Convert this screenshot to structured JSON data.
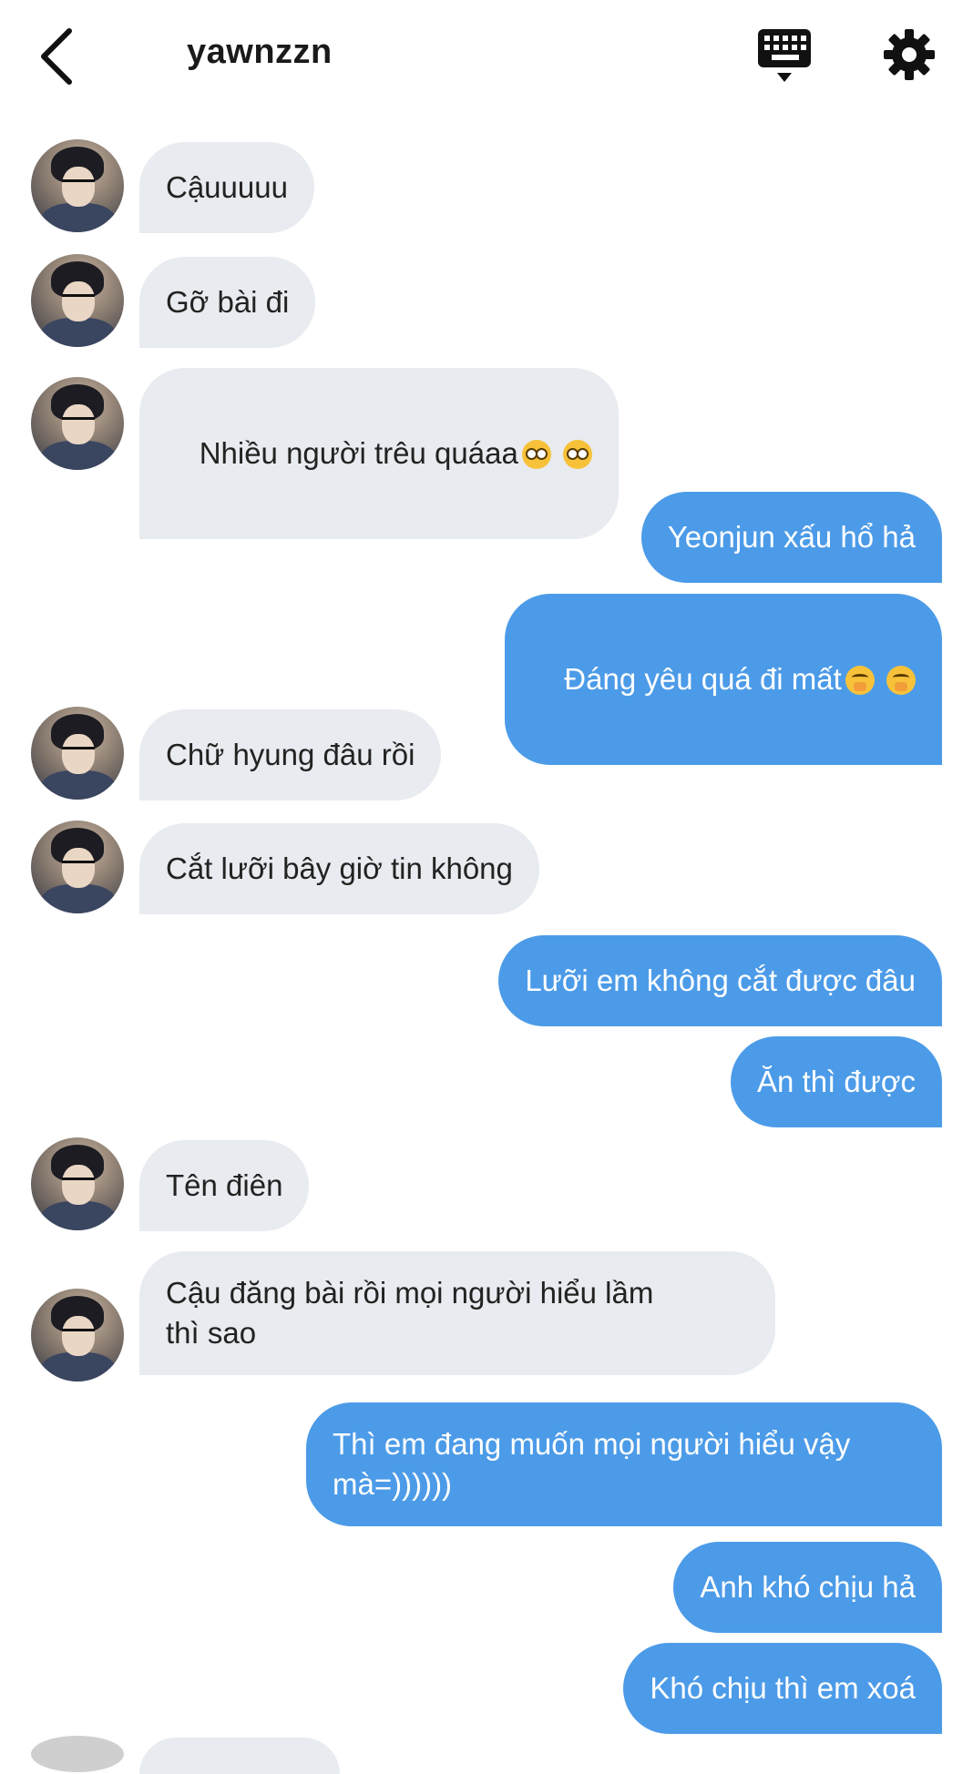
{
  "header": {
    "title": "yawnzzn",
    "back_icon": "chevron-left-icon",
    "keyboard_icon": "keyboard-icon",
    "settings_icon": "gear-icon"
  },
  "messages": [
    {
      "side": "in",
      "text": "Cậuuuuu"
    },
    {
      "side": "in",
      "text": "Gỡ bài đi"
    },
    {
      "side": "in",
      "text": "Nhiều người trêu quáaa",
      "emoji": [
        "flushed",
        "flushed"
      ]
    },
    {
      "side": "out",
      "text": "Yeonjun xấu hổ hả"
    },
    {
      "side": "out",
      "text": "Đáng yêu quá đi mất",
      "emoji": [
        "giggle",
        "giggle"
      ]
    },
    {
      "side": "in",
      "text": "Chữ hyung đâu rồi"
    },
    {
      "side": "in",
      "text": "Cắt lưỡi bây giờ tin không"
    },
    {
      "side": "out",
      "text": "Lưỡi em không cắt được đâu"
    },
    {
      "side": "out",
      "text": "Ăn thì được"
    },
    {
      "side": "in",
      "text": "Tên điên"
    },
    {
      "side": "in",
      "text": "Cậu đăng bài rồi mọi người hiểu lầm\nthì sao"
    },
    {
      "side": "out",
      "text": "Thì em đang muốn mọi người hiểu vậy\nmà=))))))"
    },
    {
      "side": "out",
      "text": "Anh khó chịu hả"
    },
    {
      "side": "out",
      "text": "Khó chịu thì em xoá"
    }
  ],
  "colors": {
    "incoming_bubble": "#e8ebef",
    "outgoing_bubble": "#4c9be8",
    "outgoing_text": "#ffffff",
    "incoming_text": "#222222"
  }
}
